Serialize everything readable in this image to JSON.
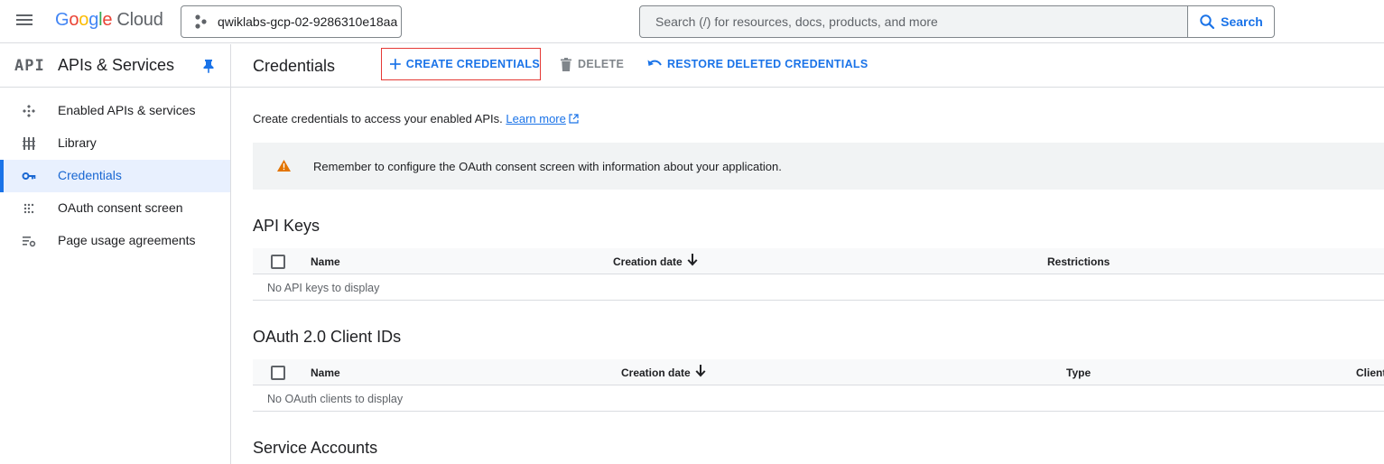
{
  "topbar": {
    "logo_google": "Google",
    "logo_cloud": "Cloud",
    "project_name": "qwiklabs-gcp-02-9286310e18aa",
    "search_placeholder": "Search (/) for resources, docs, products, and more",
    "search_button": "Search"
  },
  "sidebar": {
    "api_logo": "API",
    "title": "APIs & Services",
    "items": [
      {
        "label": "Enabled APIs & services",
        "icon": "enabled-apis-icon"
      },
      {
        "label": "Library",
        "icon": "library-icon"
      },
      {
        "label": "Credentials",
        "icon": "key-icon",
        "active": true
      },
      {
        "label": "OAuth consent screen",
        "icon": "oauth-dots-icon"
      },
      {
        "label": "Page usage agreements",
        "icon": "settings-list-icon"
      }
    ]
  },
  "toolbar": {
    "page_title": "Credentials",
    "create_label": "CREATE CREDENTIALS",
    "delete_label": "DELETE",
    "restore_label": "RESTORE DELETED CREDENTIALS"
  },
  "intro": {
    "text": "Create credentials to access your enabled APIs.",
    "learn_more": "Learn more"
  },
  "banner": {
    "text": "Remember to configure the OAuth consent screen with information about your application."
  },
  "api_keys": {
    "title": "API Keys",
    "columns": [
      "Name",
      "Creation date",
      "Restrictions"
    ],
    "empty": "No API keys to display"
  },
  "oauth_clients": {
    "title": "OAuth 2.0 Client IDs",
    "columns": [
      "Name",
      "Creation date",
      "Type",
      "Client"
    ],
    "empty": "No OAuth clients to display"
  },
  "service_accounts": {
    "title": "Service Accounts"
  },
  "colors": {
    "accent": "#1a73e8",
    "highlight_border": "#e53935",
    "warning": "#e37400"
  }
}
